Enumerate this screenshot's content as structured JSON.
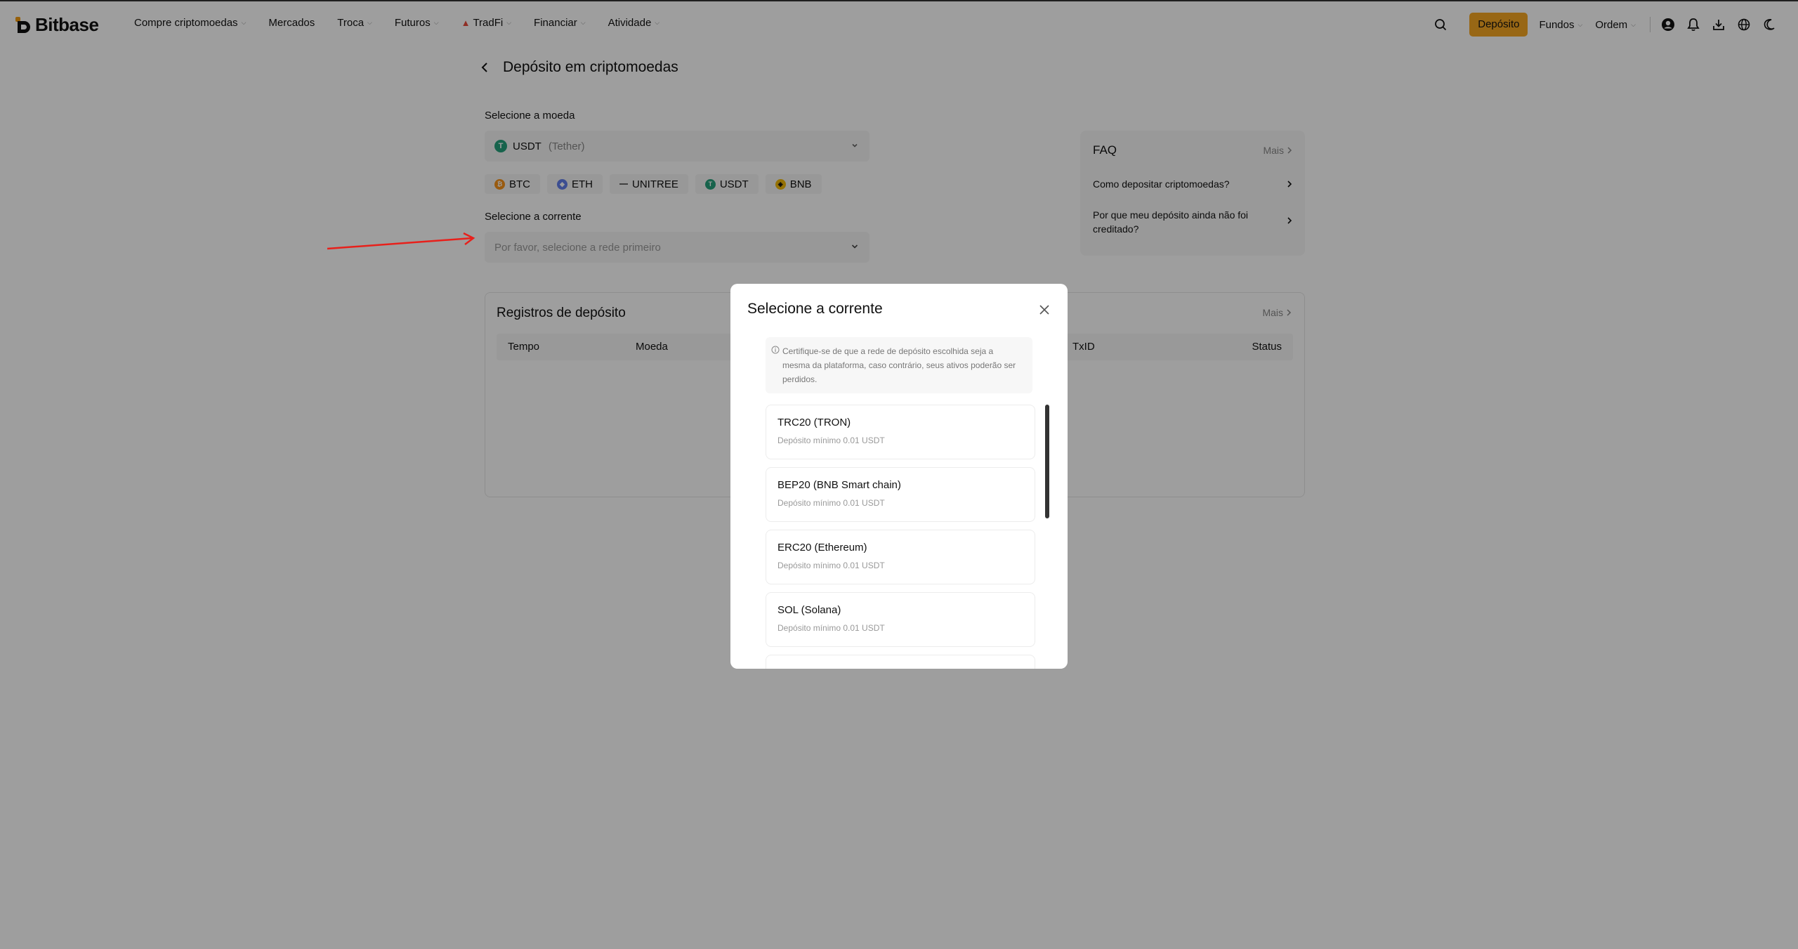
{
  "header": {
    "logo_text": "Bitbase",
    "nav": [
      {
        "label": "Compre criptomoedas",
        "dropdown": true
      },
      {
        "label": "Mercados",
        "dropdown": false
      },
      {
        "label": "Troca",
        "dropdown": true
      },
      {
        "label": "Futuros",
        "dropdown": true
      },
      {
        "label": "TradFi",
        "dropdown": true,
        "icon": "flame-icon"
      },
      {
        "label": "Financiar",
        "dropdown": true
      },
      {
        "label": "Atividade",
        "dropdown": true
      }
    ],
    "deposit_button": "Depósito",
    "funds_label": "Fundos",
    "order_label": "Ordem",
    "accent_color": "#f5a623"
  },
  "page": {
    "title": "Depósito em criptomoedas",
    "coin_section_label": "Selecione a moeda",
    "coin_selected": "USDT",
    "coin_selected_name": "(Tether)",
    "quick_coins": [
      "BTC",
      "ETH",
      "UNITREE",
      "USDT",
      "BNB"
    ],
    "network_section_label": "Selecione a corrente",
    "network_placeholder": "Por favor, selecione a rede primeiro"
  },
  "faq": {
    "title": "FAQ",
    "more": "Mais",
    "questions": [
      "Como depositar criptomoedas?",
      "Por que meu depósito ainda não foi creditado?"
    ]
  },
  "records": {
    "title": "Registros de depósito",
    "more": "Mais",
    "columns": [
      "Tempo",
      "Moeda",
      "TxID",
      "Status"
    ]
  },
  "modal": {
    "title": "Selecione a corrente",
    "notice": "Certifique-se de que a rede de depósito escolhida seja a mesma da plataforma, caso contrário, seus ativos poderão ser perdidos.",
    "networks": [
      {
        "name": "TRC20 (TRON)",
        "min": "Depósito mínimo 0.01 USDT"
      },
      {
        "name": "BEP20 (BNB Smart chain)",
        "min": "Depósito mínimo 0.01 USDT"
      },
      {
        "name": "ERC20 (Ethereum)",
        "min": "Depósito mínimo 0.01 USDT"
      },
      {
        "name": "SOL (Solana)",
        "min": "Depósito mínimo 0.01 USDT"
      }
    ]
  }
}
